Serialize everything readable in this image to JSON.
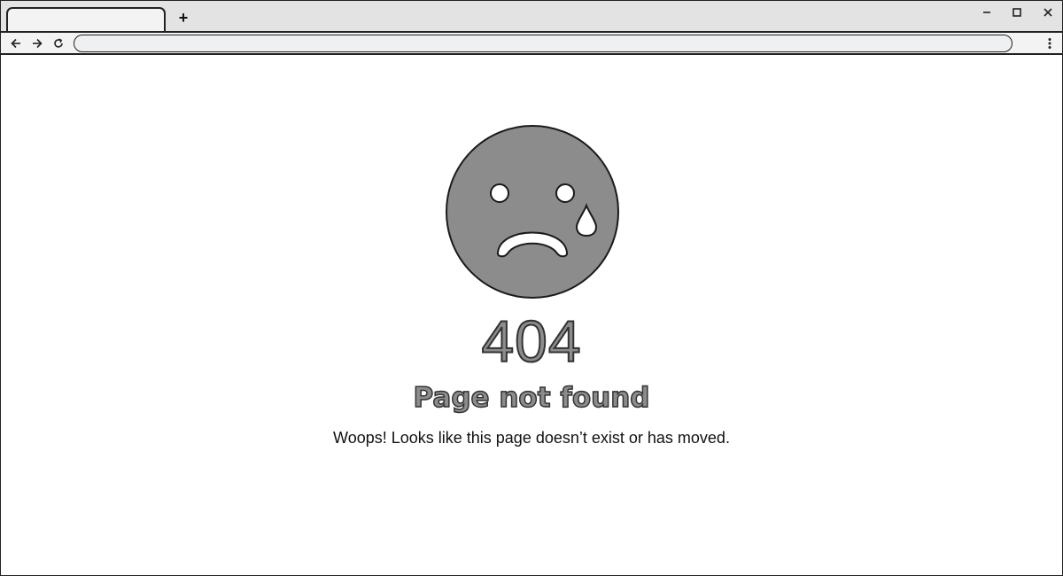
{
  "browser": {
    "tab": {
      "title": ""
    },
    "new_tab_label": "+",
    "address_bar": {
      "value": ""
    },
    "window_controls": [
      "minimize-icon",
      "maximize-icon",
      "close-icon"
    ],
    "nav_icons": [
      "back-arrow-icon",
      "forward-arrow-icon",
      "reload-icon"
    ],
    "menu_icon": "kebab-menu-icon"
  },
  "page": {
    "illustration": "sad-face-with-tear-icon",
    "error_code": "404",
    "title": "Page not found",
    "message": "Woops! Looks like this page doesn’t exist or has moved."
  },
  "colors": {
    "face_fill": "#8c8c8c",
    "outline": "#222222",
    "chrome_bg": "#e3e3e3",
    "toolbar_bg": "#f3f3f3"
  }
}
